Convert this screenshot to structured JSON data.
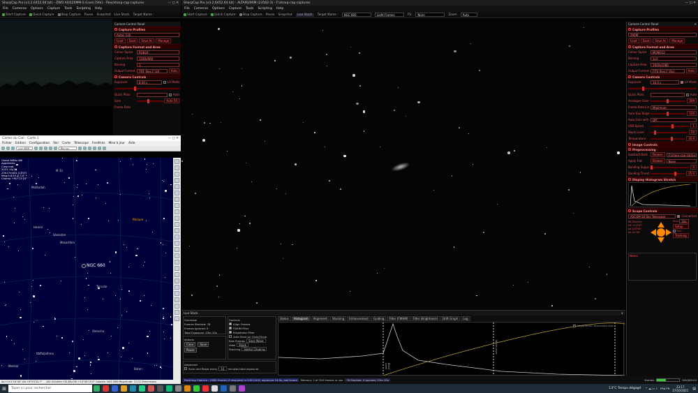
{
  "left_window": {
    "title": "SharpCap Pro (v3.2.6452.64 bit) - ZWO ASI120MM-S (Live) [Stk] - Files/sharp-cap-captures",
    "menu": [
      "File",
      "Cameras",
      "Options",
      "Capture",
      "Tools",
      "Scripting",
      "Help"
    ],
    "toolbar": [
      "Start Capture",
      "Quick Capture",
      "Stop Capture",
      "Pause",
      "Snapshot",
      "Live Stack",
      "Target Name :"
    ],
    "control_panel_title": "Camera Control Panel",
    "capture_profiles": {
      "header": "Capture Profiles",
      "value": "Autos 120",
      "buttons": [
        "Load",
        "Save",
        "Save As",
        "Manage"
      ]
    },
    "format": {
      "header": "Capture Format and Area",
      "rows": [
        [
          "Colour Space",
          "RGB24"
        ],
        [
          "Capture Area",
          "1280x960"
        ],
        [
          "Binning",
          "1"
        ],
        [
          "Output Format",
          "TIFF files (*.tif)"
        ]
      ],
      "auto": "Auto"
    },
    "camera_controls": {
      "header": "Camera Controls",
      "exposure_label": "Exposure",
      "exposure": "8.00 s",
      "lx": "LX Mode",
      "quick_picks": "Quick Picks",
      "auto": "Auto",
      "gain_label": "Gain",
      "gain": "Auto 50",
      "frame_rate": "Frame Rate"
    }
  },
  "cdc": {
    "title": "Cartes du Ciel - Carte 1",
    "menu": [
      "Fichier",
      "Edition",
      "Configuration",
      "Voir",
      "Carte",
      "Télescope",
      "Fenêtres",
      "Mise à jour",
      "Aide"
    ],
    "search": "ngc 660",
    "fov": "Pisces",
    "info_lines": [
      "Ouest AMAz Wé",
      "Apparents",
      "Crep mat",
      "2021-10-27",
      "23h17m00s (CEST)",
      "Mag:9.6/10.5 3.0'",
      "Champ +90°13'10\""
    ],
    "labels": [
      "M 33",
      "Mothallah",
      "Hamal",
      "Sheratan",
      "Mesarthim",
      "NGC 660",
      "Torcular",
      "Alrescha",
      "Kaffaljidhma",
      "Menkar",
      "Piscium",
      "Baten"
    ],
    "status_left": "Az:+1h1'54\"40\" Alt:+6°20'31.7\"",
    "status_right": "AD: 01h44m+32.83s  DE:+13°45'19.0\"  Galaxie: NGC 660  Magnitude: 12.02  Dimensions"
  },
  "main_window": {
    "title": "SharpCap Pro (v3.2.6452.64 bit) - ALTAIR290M (23582-3) - F:\\sharp-cap-captures",
    "menu": [
      "File",
      "Cameras",
      "Options",
      "Capture",
      "Tools",
      "Scripting",
      "Help"
    ],
    "toolbar": [
      "Start Capture",
      "Quick Capture",
      "Stop Capture",
      "Pause",
      "Snapshot",
      "Live Stack",
      "Target Name :"
    ],
    "target": "NGC 660",
    "frame_type": "Light Frames",
    "fit_label": "FS:",
    "fit": "None",
    "zoom_label": "Zoom",
    "zoom": "Auto"
  },
  "right_panel": {
    "title": "Camera Control Panel",
    "capture_profiles": {
      "header": "Capture Profiles",
      "value": "290M",
      "buttons": [
        "Load",
        "Save",
        "Save As",
        "Manage"
      ]
    },
    "format": {
      "header": "Capture Format and Area",
      "rows": [
        [
          "Colour Space",
          "MONO12"
        ],
        [
          "Binning",
          "1x1"
        ],
        [
          "Capture Area",
          "1920x1080"
        ],
        [
          "Output Format",
          "FITS files (*.fits)"
        ]
      ],
      "auto": "Auto"
    },
    "camera_controls": {
      "header": "Camera Controls",
      "exposure_label": "Exposure",
      "exposure": "16.0 s",
      "lx": "LX Mode",
      "quick_picks": "Quick Picks",
      "auto": "Auto",
      "rows": [
        [
          "Analogue Gain",
          "200"
        ],
        [
          "Frame Rate Limit",
          "Maximum"
        ],
        [
          "Auto Exp Target",
          "120"
        ],
        [
          "Auto Gain with Auto Exposure",
          "Off"
        ],
        [
          "USB Speed",
          "1"
        ],
        [
          "Black Level",
          "50"
        ],
        [
          "Temperature",
          "16.0"
        ]
      ]
    },
    "image_controls": "Image Controls",
    "preprocessing": {
      "header": "Preprocessing",
      "subtract_dark": "Subtract Dark",
      "dark_value": "F:\\sharp-cap-captures",
      "apply_flat": "Apply Flat",
      "flat_value": "None",
      "banding": "Banding Suppression",
      "banding_value": "0",
      "banding_threshold": "Banding Threshold",
      "threshold_value": "35.0",
      "browse": "Browse"
    },
    "histogram": "Display Histogram Stretch",
    "scope": {
      "header": "Scope Controls",
      "mount": "ASCOM SX Sky Telescope",
      "connected": "Connected",
      "rate_label": "Rate",
      "rate": "16x",
      "park": "Park",
      "setup": "Setup",
      "tracking": "Tracking",
      "coords": [
        "RA 01h43m",
        "DE +13°47'",
        "Az 123°45'",
        "Alt 41°45'"
      ]
    },
    "notes": "Notes"
  },
  "live_stack": {
    "title": "Live Stack",
    "overview": {
      "header": "Overview",
      "frames_stacked": "Frames Stacked: 78",
      "frames_ignored": "Frames Ignored: 0",
      "total_exposure": "Total Exposure: 13m 10s"
    },
    "actions": {
      "header": "Actions",
      "clear": "Clear",
      "save": "Save",
      "pause": "Pause"
    },
    "advanced": {
      "header": "Advanced",
      "save_reset": "Save and Reset every",
      "minutes": "10",
      "minutes_label": "minutes total exposure"
    },
    "controls": {
      "header": "Controls",
      "items": [
        "Align Frames",
        "FWHM Filter",
        "Brightness Filter",
        "Auto Save on Clear/Close"
      ],
      "raw_frames": "Raw Frames",
      "raw_value": "Save None",
      "view": "View",
      "view_value": "Stack",
      "stacking": "Stacking",
      "stacking_value": "Sigma Clipping"
    },
    "tabs": [
      "Status",
      "Histogram",
      "Alignment",
      "Stacking",
      "Enhancement",
      "Guiding",
      "Filter (FWHM)",
      "Filter (Brightness)",
      "Drift Graph",
      "Log"
    ],
    "active_tab": "Histogram",
    "hist_option": "Logarithmic Horizontal Axis",
    "black_point": "Black Level",
    "white_point": "White Level"
  },
  "status": {
    "left": "Finishing Capture : 1082 frames (0 dropped) in 0:00:16.8, exposure 16.0s, last frame",
    "memory": "Memory: 2 of 250 frames in use",
    "stack": "78 Stacked, 0 Ignored, 13m 10s",
    "frames_label": "Frames",
    "frames_value": "0/00/00:04"
  },
  "taskbar": {
    "search": "Taper ici pour rechercher",
    "weather": "13°C Temps dégagé",
    "time": "23:17",
    "date": "27/10/2021",
    "lang": "FRA FR",
    "accent": "#1f2a37"
  }
}
